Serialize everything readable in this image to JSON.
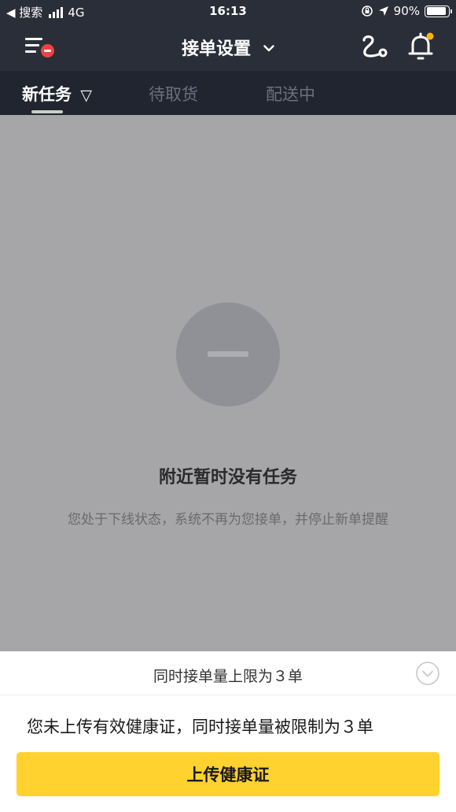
{
  "status_bar": {
    "back_label": "◀ 搜索",
    "network": "4G",
    "time": "16:13",
    "battery": "90%",
    "battery_level": 0.9
  },
  "header": {
    "title": "接单设置",
    "icons": [
      "menu-icon",
      "offline-badge-icon",
      "chevron-down-icon",
      "route-icon",
      "bell-icon"
    ],
    "notification_dot_color": "#ffb400"
  },
  "tabs": [
    {
      "label": "新任务",
      "active": true,
      "filter_glyph": "▽"
    },
    {
      "label": "待取货",
      "active": false
    },
    {
      "label": "配送中",
      "active": false
    }
  ],
  "empty_state": {
    "title": "附近暂时没有任务",
    "description": "您处于下线状态，系统不再为您接单，并停止新单提醒"
  },
  "bottom_sheet": {
    "limit_text": "同时接单量上限为３单",
    "warning": "您未上传有效健康证，同时接单量被限制为３单",
    "button_label": "上传健康证",
    "button_color": "#ffd22f"
  }
}
